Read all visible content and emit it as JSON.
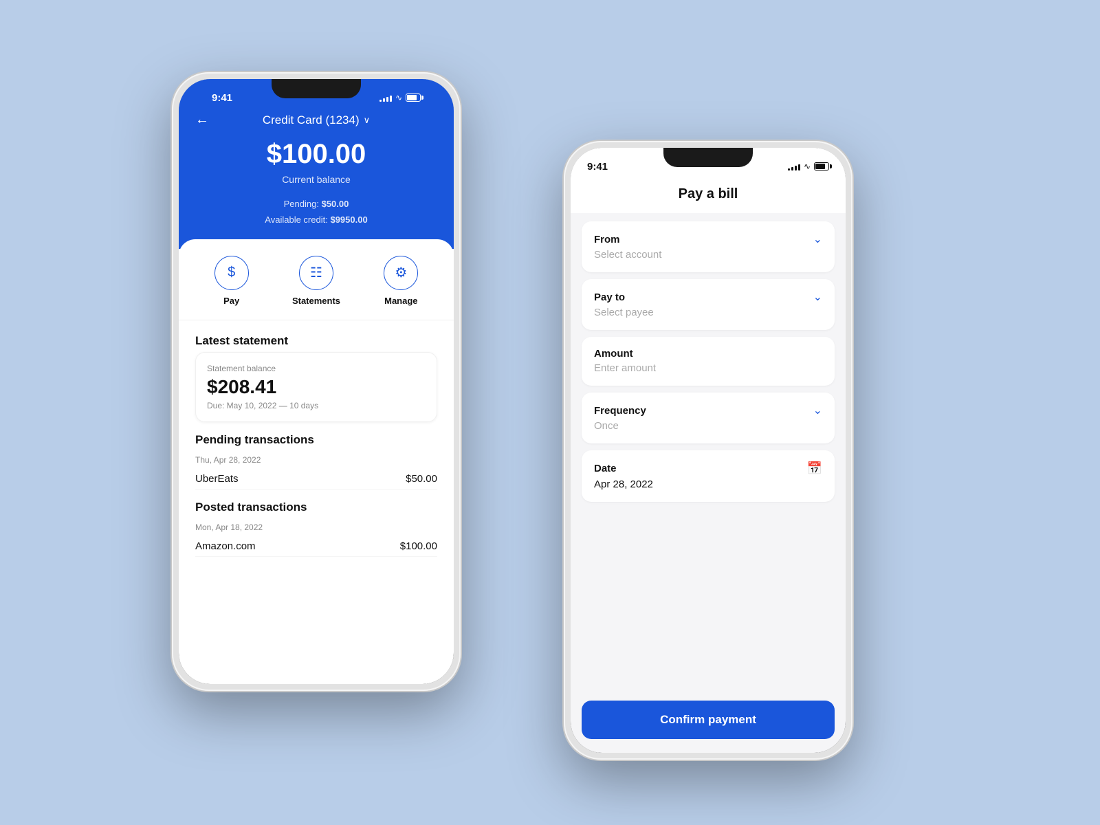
{
  "background": "#b8cde8",
  "phone1": {
    "status": {
      "time": "9:41",
      "signal": [
        3,
        5,
        7,
        9,
        11
      ],
      "wifi": "wifi",
      "battery": "battery"
    },
    "nav": {
      "back": "←",
      "title": "Credit Card (1234)",
      "chevron": "∨"
    },
    "balance": {
      "amount": "$100.00",
      "label": "Current balance",
      "pending": "Pending:",
      "pending_amount": "$50.00",
      "available": "Available credit:",
      "available_amount": "$9950.00"
    },
    "actions": [
      {
        "icon": "$",
        "label": "Pay"
      },
      {
        "icon": "≡",
        "label": "Statements"
      },
      {
        "icon": "⚙",
        "label": "Manage"
      }
    ],
    "latest_statement": {
      "title": "Latest statement",
      "sublabel": "Statement balance",
      "amount": "$208.41",
      "due": "Due: May 10, 2022 — 10 days"
    },
    "pending_transactions": {
      "title": "Pending transactions",
      "date": "Thu, Apr 28, 2022",
      "items": [
        {
          "name": "UberEats",
          "amount": "$50.00"
        }
      ]
    },
    "posted_transactions": {
      "title": "Posted transactions",
      "date": "Mon, Apr 18, 2022",
      "items": [
        {
          "name": "Amazon.com",
          "amount": "$100.00"
        }
      ]
    }
  },
  "phone2": {
    "status": {
      "time": "9:41",
      "signal": [
        3,
        5,
        7,
        9,
        11
      ],
      "wifi": "wifi",
      "battery": "battery"
    },
    "page_title": "Pay a bill",
    "fields": [
      {
        "label": "From",
        "value": "Select account",
        "type": "dropdown"
      },
      {
        "label": "Pay to",
        "value": "Select payee",
        "type": "dropdown"
      },
      {
        "label": "Amount",
        "value": "Enter amount",
        "type": "text"
      },
      {
        "label": "Frequency",
        "value": "Once",
        "type": "dropdown"
      },
      {
        "label": "Date",
        "value": "Apr 28, 2022",
        "type": "calendar"
      }
    ],
    "confirm_button": "Confirm payment"
  }
}
